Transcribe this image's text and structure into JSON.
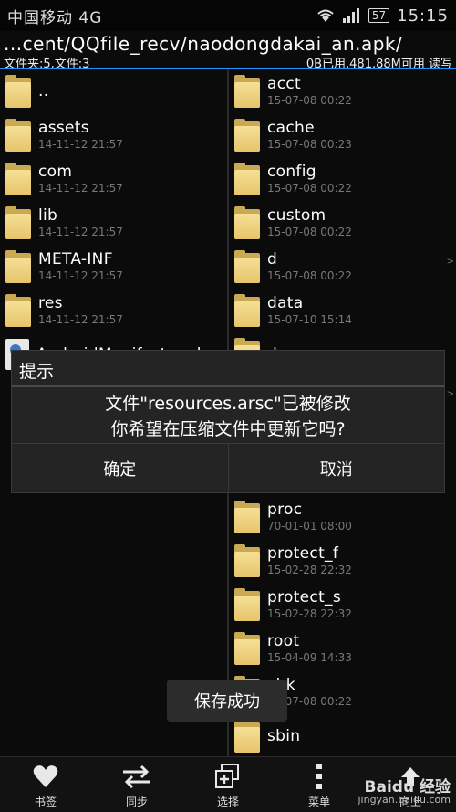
{
  "status": {
    "carrier": "中国移动 4G",
    "battery": "57",
    "time": "15:15"
  },
  "path": {
    "text": "...cent/QQfile_recv/naodongdakai_an.apk/",
    "count": "文件夹:5,文件:3",
    "storage": "0B已用,481.88M可用 读写"
  },
  "left_pane": {
    "items": [
      {
        "name": "..",
        "date": "",
        "type": "folder"
      },
      {
        "name": "assets",
        "date": "14-11-12 21:57",
        "type": "folder"
      },
      {
        "name": "com",
        "date": "14-11-12 21:57",
        "type": "folder"
      },
      {
        "name": "lib",
        "date": "14-11-12 21:57",
        "type": "folder"
      },
      {
        "name": "META-INF",
        "date": "14-11-12 21:57",
        "type": "folder"
      },
      {
        "name": "res",
        "date": "14-11-12 21:57",
        "type": "folder"
      },
      {
        "name": "AndroidManifest.xml",
        "date": "",
        "type": "file"
      }
    ]
  },
  "right_pane": {
    "items_top": [
      {
        "name": "acct",
        "date": "15-07-08 00:22"
      },
      {
        "name": "cache",
        "date": "15-07-08 00:23"
      },
      {
        "name": "config",
        "date": "15-07-08 00:22"
      },
      {
        "name": "custom",
        "date": "15-07-08 00:22"
      },
      {
        "name": "d",
        "date": "15-07-08 00:22"
      },
      {
        "name": "data",
        "date": "15-07-10 15:14"
      },
      {
        "name": "dev",
        "date": ""
      }
    ],
    "items_bottom": [
      {
        "name": "proc",
        "date": "70-01-01 08:00"
      },
      {
        "name": "protect_f",
        "date": "15-02-28 22:32"
      },
      {
        "name": "protect_s",
        "date": "15-02-28 22:32"
      },
      {
        "name": "root",
        "date": "15-04-09 14:33"
      },
      {
        "name": "chk",
        "date": "15-07-08 00:22"
      },
      {
        "name": "sbin",
        "date": ""
      }
    ]
  },
  "dialog": {
    "title": "提示",
    "message_line1": "文件\"resources.arsc\"已被修改",
    "message_line2": "你希望在压缩文件中更新它吗?",
    "ok": "确定",
    "cancel": "取消"
  },
  "toast": "保存成功",
  "toolbar": [
    {
      "label": "书签",
      "icon": "heart-icon"
    },
    {
      "label": "同步",
      "icon": "sync-arrows-icon"
    },
    {
      "label": "选择",
      "icon": "multi-select-icon"
    },
    {
      "label": "菜单",
      "icon": "menu-dots-icon"
    },
    {
      "label": "向上",
      "icon": "up-icon"
    }
  ],
  "watermark": {
    "brand": "Baidu 经验",
    "url": "jingyan.baidu.com"
  }
}
